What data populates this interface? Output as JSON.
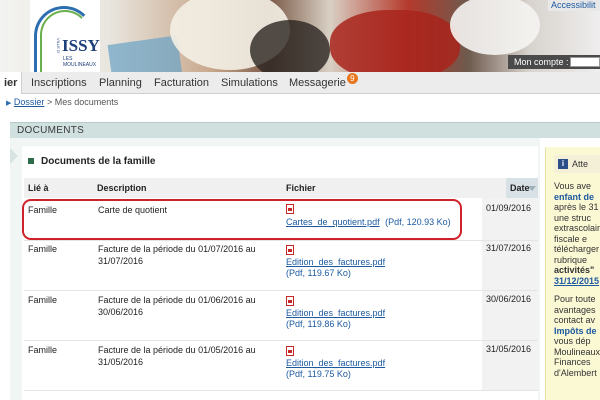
{
  "header": {
    "logo_name": "ISSY",
    "logo_sub": "LES MOULINEAUX",
    "logo_vertical": "VILLE D'",
    "accessibility_label": "Accessibilit",
    "account_label": "Mon compte :"
  },
  "nav": {
    "tabs": [
      {
        "label": "ier"
      },
      {
        "label": "Inscriptions"
      },
      {
        "label": "Planning"
      },
      {
        "label": "Facturation"
      },
      {
        "label": "Simulations"
      },
      {
        "label": "Messagerie",
        "badge": "9"
      }
    ]
  },
  "breadcrumb": {
    "parent": "Dossier",
    "separator": ">",
    "current": "Mes documents"
  },
  "documents": {
    "header": "DOCUMENTS",
    "section_title": "Documents de la famille",
    "columns": {
      "lie": "Lié à",
      "description": "Description",
      "fichier": "Fichier",
      "date": "Date"
    },
    "rows": [
      {
        "lie": "Famille",
        "description": "Carte de quotient",
        "file": "Cartes_de_quotient.pdf",
        "meta": "(Pdf, 120.93 Ko)",
        "date": "01/09/2016"
      },
      {
        "lie": "Famille",
        "description": "Facture de la période du 01/07/2016 au 31/07/2016",
        "file": "Edition_des_factures.pdf",
        "meta": "(Pdf, 119.67 Ko)",
        "date": "31/07/2016"
      },
      {
        "lie": "Famille",
        "description": "Facture de la période du 01/06/2016 au 30/06/2016",
        "file": "Edition_des_factures.pdf",
        "meta": "(Pdf, 119.86 Ko)",
        "date": "30/06/2016"
      },
      {
        "lie": "Famille",
        "description": "Facture de la période du 01/05/2016 au 31/05/2016",
        "file": "Edition_des_factures.pdf",
        "meta": "(Pdf, 119.75 Ko)",
        "date": "31/05/2016"
      }
    ]
  },
  "sidebar": {
    "info_glyph": "i",
    "title": "Atte",
    "p1": {
      "a": "Vous ave",
      "b": "enfant de",
      "c": "après le 31",
      "d": "une struc",
      "e": "extrascolair",
      "f": "fiscale e",
      "g": "télécharger",
      "h": "rubrique",
      "i": "activités\"",
      "j": "31/12/2015"
    },
    "p2": {
      "a": "Pour toute",
      "b": "avantages",
      "c": "contact av",
      "d": "Impôts de",
      "e": "vous dép",
      "f": "Moulineaux",
      "g": "Finances",
      "h": "d'Alembert"
    }
  },
  "colors": {
    "accent_blue": "#1d5aa0",
    "highlight_red": "#d0212a",
    "section_bg": "#cfe0df",
    "badge_orange": "#e8761e",
    "sidebar_bg": "#fbf8d4"
  }
}
